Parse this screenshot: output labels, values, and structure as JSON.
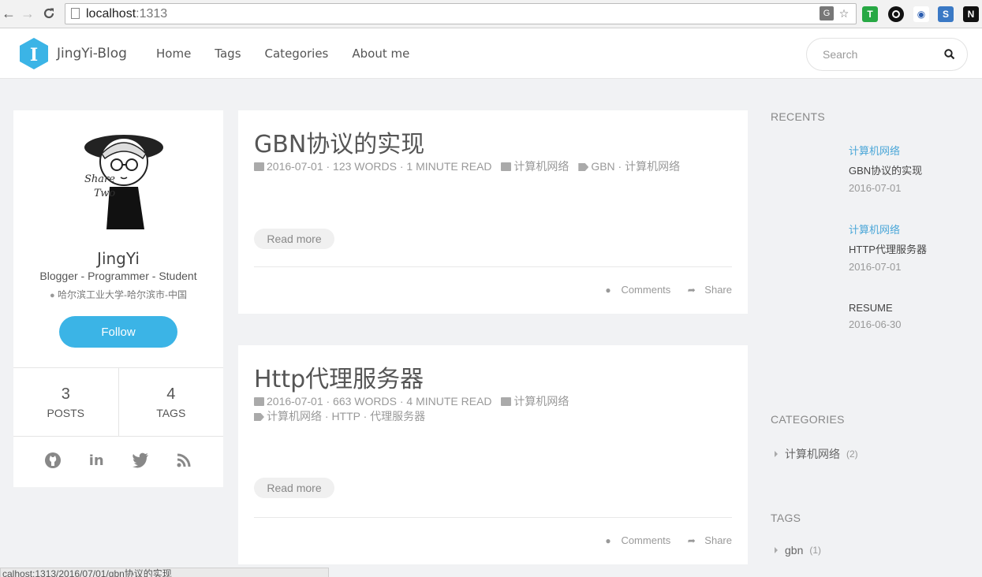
{
  "browser": {
    "url_host": "localhost",
    "url_port": ":1313",
    "status_url": "calhost:1313/2016/07/01/gbn协议的实现"
  },
  "site": {
    "title": "JingYi-Blog",
    "logo_letter": "I",
    "accent_color": "#3bb4e6",
    "nav": [
      "Home",
      "Tags",
      "Categories",
      "About me"
    ],
    "search_placeholder": "Search"
  },
  "profile": {
    "name": "JingYi",
    "role": "Blogger - Programmer - Student",
    "location": "哈尔滨工业大学-哈尔滨市-中国",
    "follow_label": "Follow",
    "avatar_caption_1": "Share",
    "avatar_caption_2": "Two",
    "stats": [
      {
        "value": "3",
        "label": "POSTS"
      },
      {
        "value": "4",
        "label": "TAGS"
      }
    ],
    "social_icons": [
      "github-icon",
      "linkedin-icon",
      "twitter-icon",
      "rss-icon"
    ]
  },
  "posts": [
    {
      "title": "GBN协议的实现",
      "meta": "2016-07-01 · 123 WORDS · 1 MINUTE READ",
      "category": "计算机网络",
      "tags": "GBN · 计算机网络",
      "read_more": "Read more",
      "comments": "Comments",
      "share": "Share"
    },
    {
      "title": "Http代理服务器",
      "meta": "2016-07-01 · 663 WORDS · 4 MINUTE READ",
      "category": "计算机网络",
      "tags": "计算机网络 · HTTP · 代理服务器",
      "read_more": "Read more",
      "comments": "Comments",
      "share": "Share"
    }
  ],
  "sidebar": {
    "recents_heading": "RECENTS",
    "recents": [
      {
        "category": "计算机网络",
        "title": "GBN协议的实现",
        "date": "2016-07-01"
      },
      {
        "category": "计算机网络",
        "title": "HTTP代理服务器",
        "date": "2016-07-01"
      },
      {
        "category": "",
        "title": "RESUME",
        "date": "2016-06-30"
      }
    ],
    "categories_heading": "CATEGORIES",
    "categories": [
      {
        "name": "计算机网络",
        "count": "(2)"
      }
    ],
    "tags_heading": "TAGS",
    "tags": [
      {
        "name": "gbn",
        "count": "(1)"
      }
    ]
  }
}
